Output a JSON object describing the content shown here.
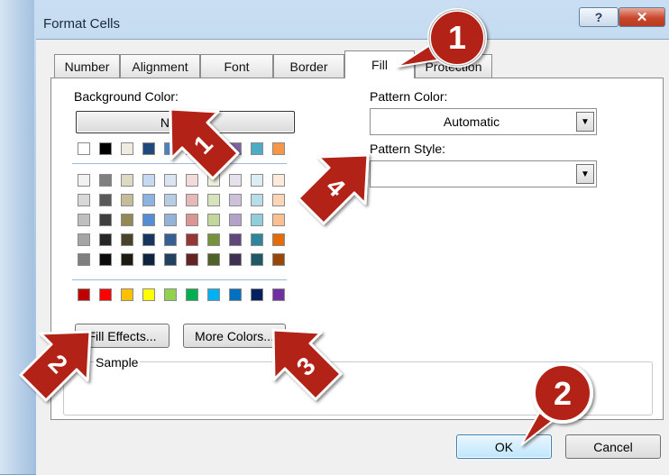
{
  "window": {
    "title": "Format Cells",
    "help_glyph": "?",
    "close_glyph": "✕"
  },
  "tabs": [
    {
      "label": "Number"
    },
    {
      "label": "Alignment"
    },
    {
      "label": "Font"
    },
    {
      "label": "Border"
    },
    {
      "label": "Fill"
    },
    {
      "label": "Protection"
    }
  ],
  "background": {
    "label": "Background Color:",
    "no_color_label": "No Color",
    "row_top": [
      "#ffffff",
      "#000000",
      "#eeece1",
      "#1f497d",
      "#4f81bd",
      "#c0504d",
      "#9bbb59",
      "#8064a2",
      "#4bacc6",
      "#f79646"
    ],
    "rows_shades": [
      [
        "#f2f2f2",
        "#7f7f7f",
        "#ddd9c3",
        "#c6d9f0",
        "#dbe5f1",
        "#f2dcdb",
        "#ebf1dd",
        "#e5e0ec",
        "#dbeef3",
        "#fdeada"
      ],
      [
        "#d8d8d8",
        "#595959",
        "#c4bd97",
        "#8db3e2",
        "#b8cce4",
        "#e5b9b7",
        "#d7e3bc",
        "#ccc1d9",
        "#b7dde8",
        "#fbd5b5"
      ],
      [
        "#bfbfbf",
        "#3f3f3f",
        "#938953",
        "#548dd4",
        "#95b3d7",
        "#d99694",
        "#c3d69b",
        "#b2a2c7",
        "#92cddc",
        "#fac08f"
      ],
      [
        "#a5a5a5",
        "#262626",
        "#494429",
        "#17365d",
        "#366092",
        "#953734",
        "#76923c",
        "#5f497a",
        "#31859b",
        "#e36c09"
      ],
      [
        "#7f7f7f",
        "#0c0c0c",
        "#1d1b10",
        "#0f243e",
        "#244061",
        "#632423",
        "#4f6128",
        "#3f3151",
        "#205867",
        "#974806"
      ]
    ],
    "row_standard": [
      "#c00000",
      "#ff0000",
      "#ffc000",
      "#ffff00",
      "#92d050",
      "#00b050",
      "#00b0f0",
      "#0070c0",
      "#002060",
      "#7030a0"
    ]
  },
  "buttons": {
    "fill_effects": "Fill Effects...",
    "more_colors": "More Colors...",
    "ok": "OK",
    "cancel": "Cancel"
  },
  "pattern": {
    "color_label": "Pattern Color:",
    "color_value": "Automatic",
    "style_label": "Pattern Style:",
    "style_value": ""
  },
  "sample": {
    "label": "Sample"
  },
  "callouts": [
    {
      "number": "1"
    },
    {
      "number": "1"
    },
    {
      "number": "2"
    },
    {
      "number": "2"
    },
    {
      "number": "3"
    },
    {
      "number": "4"
    }
  ],
  "colors": {
    "callout": "#b32317",
    "accent": "#3c7fb1"
  }
}
